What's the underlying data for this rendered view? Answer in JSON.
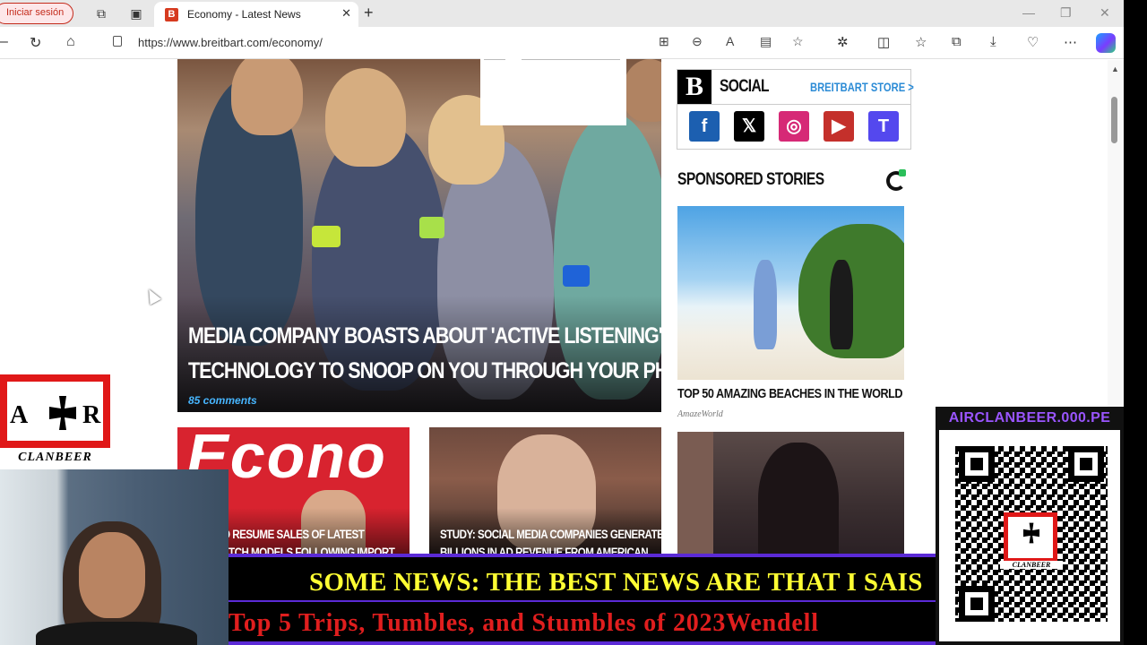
{
  "browser": {
    "signin_label": "Iniciar sesión",
    "tab_title": "Economy - Latest News",
    "tab_favicon_letter": "B",
    "url": "https://www.breitbart.com/economy/"
  },
  "hero": {
    "title_line1": "MEDIA COMPANY BOASTS ABOUT 'ACTIVE LISTENING'",
    "title_line2": "TECHNOLOGY TO SNOOP ON YOU THROUGH YOUR PHONE",
    "comments": "85 comments"
  },
  "cards": [
    {
      "bg_text": "Econo",
      "line1": "O RESUME SALES OF LATEST",
      "line2": "ATCH MODELS FOLLOWING IMPORT"
    },
    {
      "line1": "STUDY: SOCIAL MEDIA COMPANIES GENERATE",
      "line2": "BILLIONS IN AD REVENUE FROM AMERICAN"
    }
  ],
  "sidebar": {
    "social_logo": "B",
    "social_label": "SOCIAL",
    "store_link": "BREITBART STORE >",
    "social_icons": [
      {
        "name": "facebook-icon",
        "glyph": "f",
        "color": "#1c5fb0"
      },
      {
        "name": "x-icon",
        "glyph": "𝕏",
        "color": "#000000"
      },
      {
        "name": "instagram-icon",
        "glyph": "◎",
        "color": "#d62976"
      },
      {
        "name": "youtube-icon",
        "glyph": "▶",
        "color": "#c4302b"
      },
      {
        "name": "truth-social-icon",
        "glyph": "T",
        "color": "#5448ee"
      }
    ],
    "sponsored_heading": "SPONSORED STORIES",
    "sponsored_items": [
      {
        "title": "TOP 50 AMAZING BEACHES IN THE WORLD",
        "source": "AmazeWorld"
      }
    ]
  },
  "overlay": {
    "clan_letter_left": "A",
    "clan_letter_right": "R",
    "clan_name": "CLANBEER",
    "ticker_line1": "SOME NEWS: THE BEST NEWS ARE THAT I SAIS",
    "ticker_line2": "Top 5 Trips, Tumbles, and Stumbles of 2023Wendell",
    "qr_site": "AIRCLANBEER.000.PE",
    "qr_mini_name": "CLANBEER"
  },
  "colors": {
    "brand_red": "#d63a1f",
    "store_link_blue": "#2d8cd6",
    "ticker_yellow": "#ffff33",
    "ticker_red": "#e01e1e",
    "qr_site_purple": "#9a55ff"
  }
}
